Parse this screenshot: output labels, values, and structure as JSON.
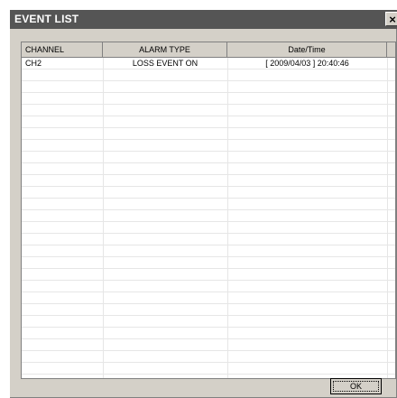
{
  "window": {
    "title": "EVENT LIST",
    "close_glyph": "×"
  },
  "table": {
    "columns": [
      "CHANNEL",
      "ALARM TYPE",
      "Date/Time"
    ],
    "rows": [
      {
        "channel": "CH2",
        "alarm_type": "LOSS EVENT ON",
        "datetime": "[ 2009/04/03 ] 20:40:46"
      }
    ]
  },
  "buttons": {
    "ok": "OK"
  },
  "colors": {
    "titlebar": "#555555",
    "window_bg": "#d4d0c8",
    "list_bg": "#ffffff"
  }
}
